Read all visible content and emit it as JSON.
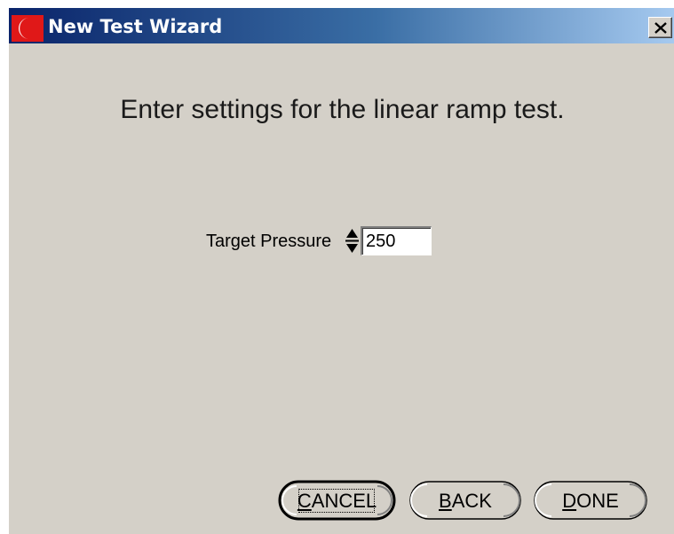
{
  "window": {
    "title": "New Test Wizard",
    "app_icon": "moon-crescent-icon",
    "close_label": "close-icon"
  },
  "main": {
    "heading": "Enter settings for the linear ramp test.",
    "fields": [
      {
        "label": "Target Pressure",
        "value": "250",
        "control": "spinner"
      }
    ]
  },
  "buttons": {
    "cancel": {
      "label": "CANCEL",
      "mnemonic": "C",
      "rest": "ANCEL",
      "focused": true
    },
    "back": {
      "label": "BACK",
      "mnemonic": "B",
      "rest": "ACK"
    },
    "done": {
      "label": "DONE",
      "mnemonic": "D",
      "rest": "ONE"
    }
  },
  "colors": {
    "title_gradient_start": "#0a246a",
    "title_gradient_end": "#a6caf0",
    "dialog_face": "#d4d0c8",
    "icon_red": "#e01818"
  }
}
